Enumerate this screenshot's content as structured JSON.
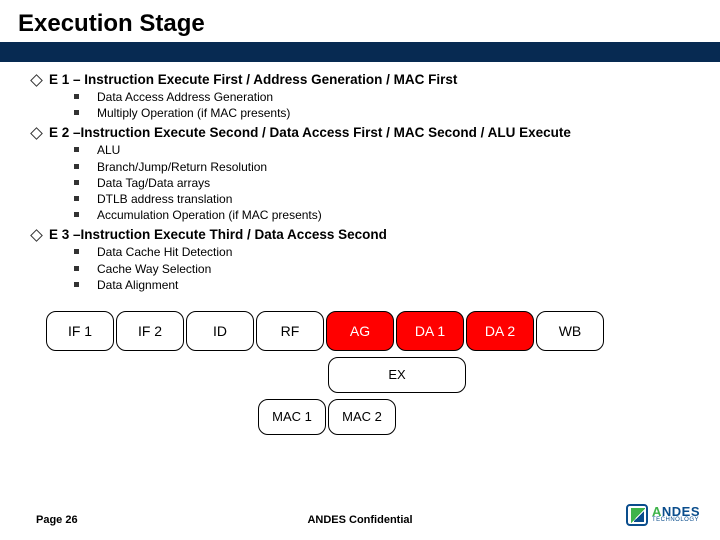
{
  "title": "Execution Stage",
  "sections": [
    {
      "head": "E 1 – Instruction Execute First / Address Generation / MAC First",
      "items": [
        "Data Access Address Generation",
        "Multiply Operation (if MAC presents)"
      ]
    },
    {
      "head": "E 2 –Instruction Execute Second / Data Access First / MAC Second / ALU Execute",
      "items": [
        "ALU",
        "Branch/Jump/Return Resolution",
        "Data Tag/Data arrays",
        "DTLB address translation",
        "Accumulation Operation (if MAC presents)"
      ]
    },
    {
      "head": "E 3 –Instruction Execute Third / Data Access Second",
      "items": [
        "Data Cache Hit Detection",
        "Cache Way Selection",
        "Data Alignment"
      ]
    }
  ],
  "pipeline": {
    "row1": [
      "IF 1",
      "IF 2",
      "ID",
      "RF",
      "AG",
      "DA 1",
      "DA 2",
      "WB"
    ],
    "highlight": [
      4,
      5,
      6
    ],
    "row2": [
      "EX"
    ],
    "row3": [
      "MAC 1",
      "MAC 2"
    ]
  },
  "footer": {
    "page": "Page 26",
    "confidential": "ANDES Confidential"
  },
  "logo": {
    "main_a": "A",
    "main_rest": "NDES",
    "sub": "TECHNOLOGY"
  }
}
